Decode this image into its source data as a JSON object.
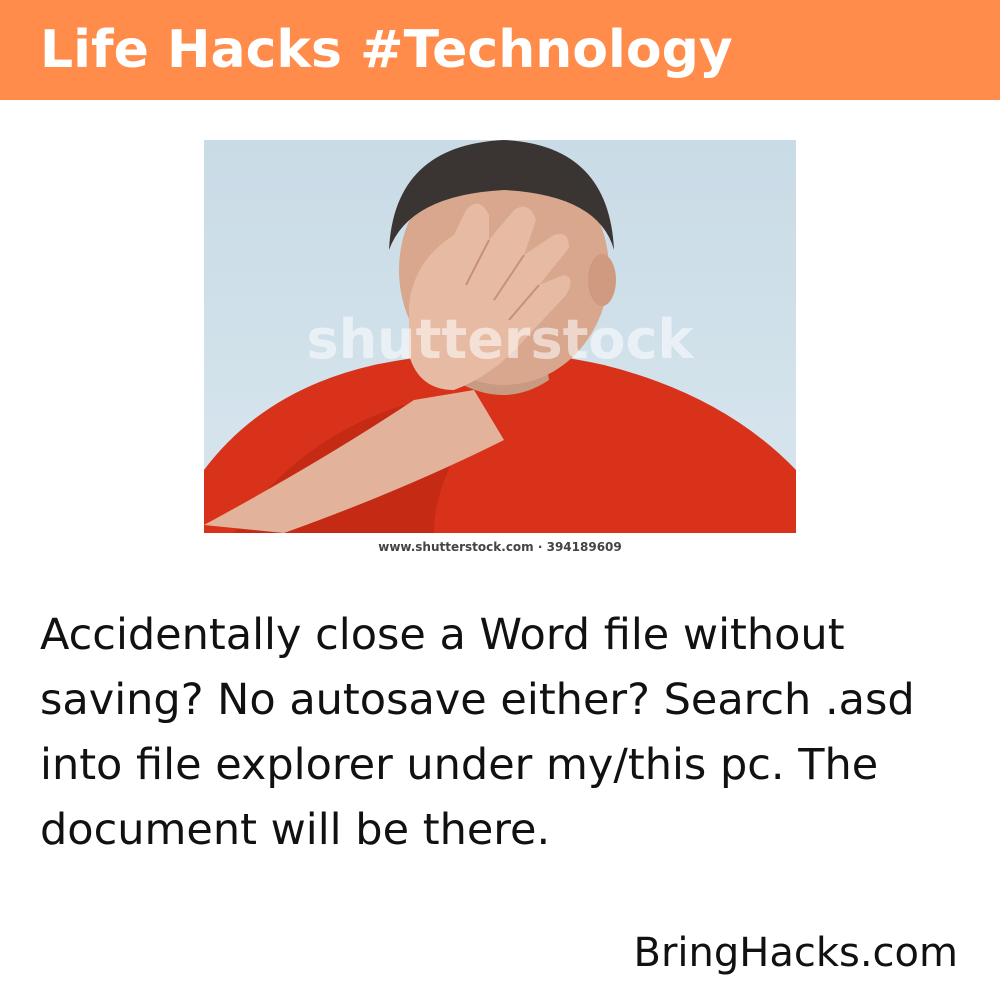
{
  "header": {
    "title": "Life Hacks #Technology",
    "background_color": "#ff8c4a"
  },
  "image": {
    "watermark": "shutterstock",
    "credit": "www.shutterstock.com · 394189609"
  },
  "content": {
    "tip": "Accidentally close a Word file without saving? No autosave either? Search .asd into file explorer under my/this pc. The document will be there."
  },
  "footer": {
    "brand": "BringHacks.com"
  }
}
